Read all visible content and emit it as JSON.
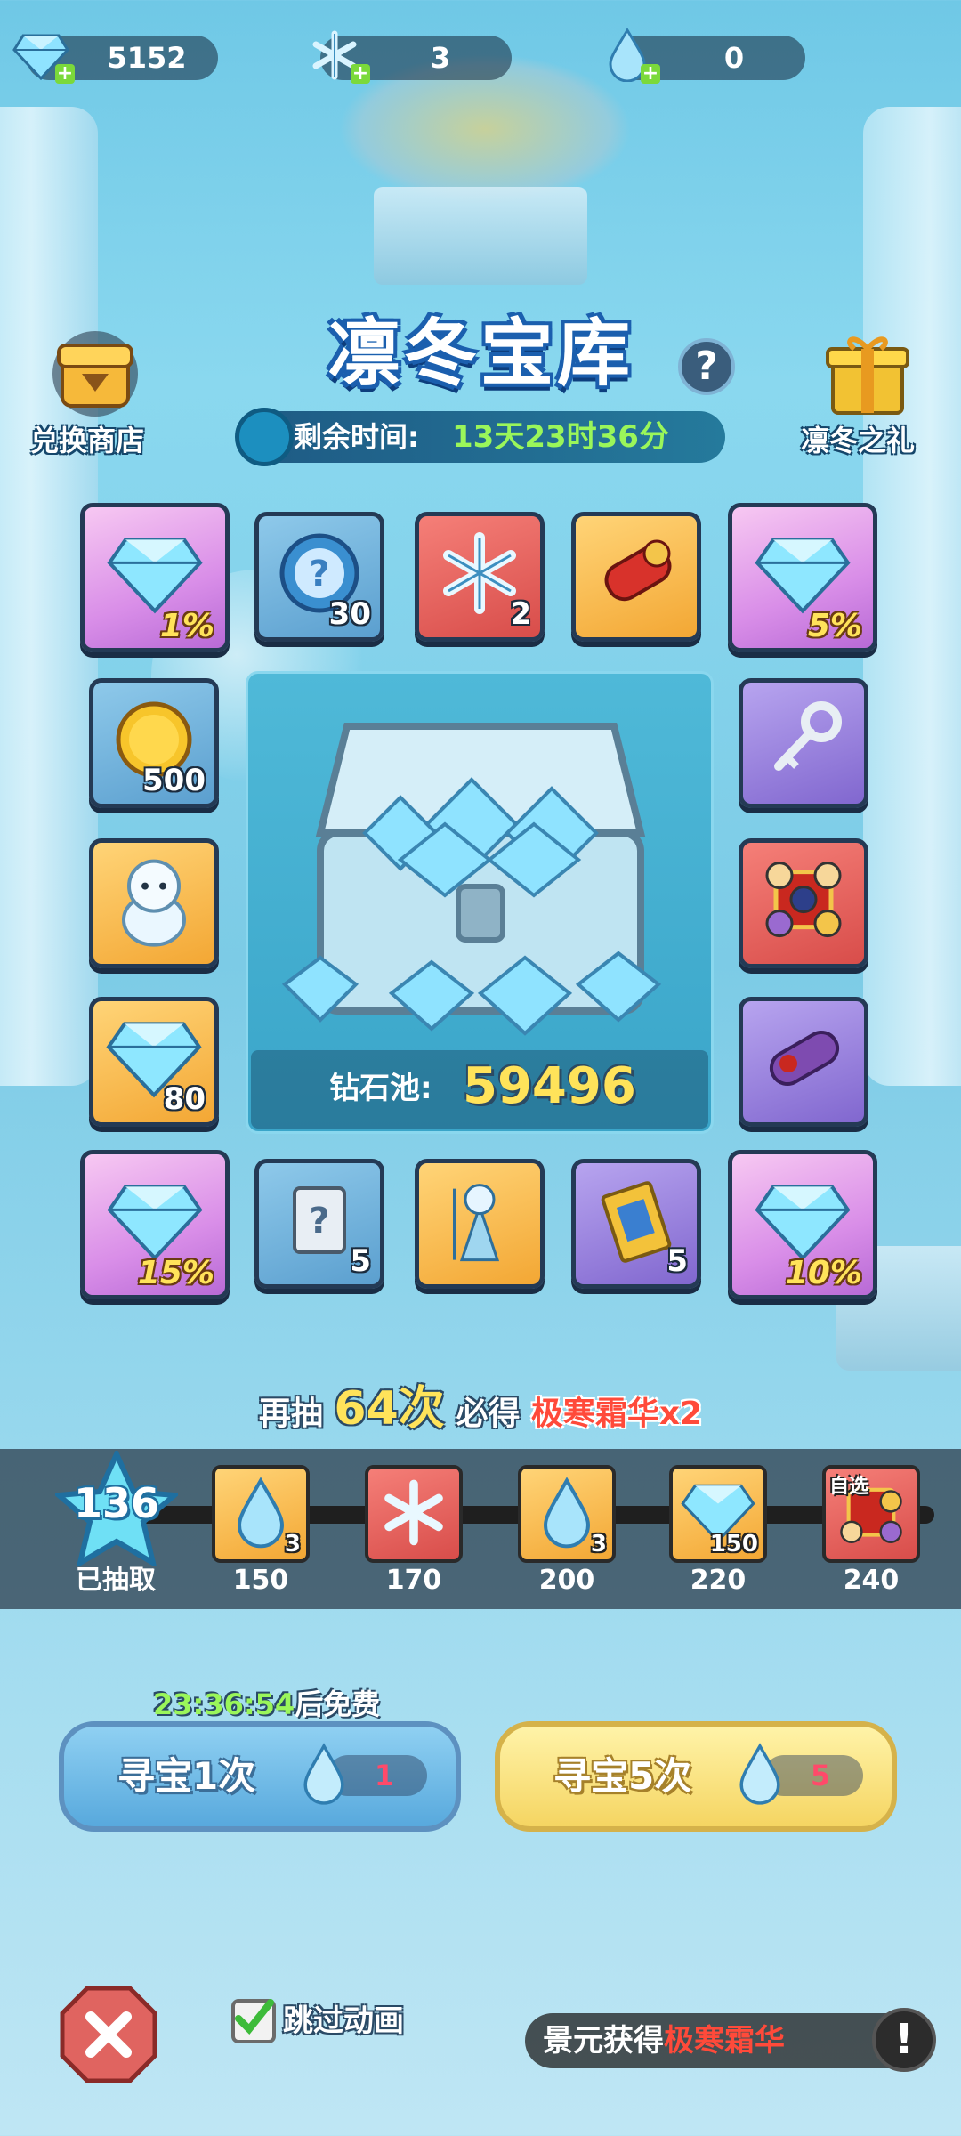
{
  "currencies": [
    {
      "name": "diamond",
      "value": "5152",
      "icon": "diamond-icon"
    },
    {
      "name": "snowflake",
      "value": "3",
      "icon": "snowflake-icon"
    },
    {
      "name": "ice-drop",
      "value": "0",
      "icon": "ice-drop-icon"
    }
  ],
  "header": {
    "title": "凛冬宝库",
    "timer_label": "剩余时间:",
    "timer_value": "13天23时36分"
  },
  "side": {
    "shop_label": "兑换商店",
    "gift_label": "凛冬之礼"
  },
  "grid": {
    "top_row": [
      {
        "type": "diamond",
        "text": "1%",
        "color": "pink"
      },
      {
        "type": "mystery-orb",
        "text": "30",
        "color": "blue"
      },
      {
        "type": "snowflake",
        "text": "2",
        "color": "red"
      },
      {
        "type": "red-scroll",
        "text": "",
        "color": "gold"
      },
      {
        "type": "diamond",
        "text": "5%",
        "color": "pink"
      }
    ],
    "left_col": [
      {
        "type": "gold-coin",
        "text": "500",
        "color": "blue"
      },
      {
        "type": "snow-creature",
        "text": "",
        "color": "gold"
      },
      {
        "type": "diamond",
        "text": "80",
        "color": "gold"
      }
    ],
    "right_col": [
      {
        "type": "key",
        "text": "",
        "color": "purple"
      },
      {
        "type": "hero-pack",
        "text": "",
        "color": "red"
      },
      {
        "type": "purple-scroll",
        "text": "",
        "color": "purple"
      }
    ],
    "bottom_row": [
      {
        "type": "diamond",
        "text": "15%",
        "color": "pink"
      },
      {
        "type": "mystery-scroll",
        "text": "5",
        "color": "blue"
      },
      {
        "type": "ice-queen",
        "text": "",
        "color": "gold"
      },
      {
        "type": "ticket",
        "text": "5",
        "color": "purple"
      },
      {
        "type": "diamond",
        "text": "10%",
        "color": "pink"
      }
    ]
  },
  "pool": {
    "label": "钻石池:",
    "value": "59496"
  },
  "guarantee": {
    "prefix": "再抽",
    "count": "64次",
    "middle": "必得",
    "reward": "极寒霜华x2"
  },
  "progress": {
    "drawn_count": "136",
    "drawn_label": "已抽取",
    "milestones": [
      {
        "threshold": "150",
        "item": "ice-drop",
        "qty": "3",
        "color": "gold"
      },
      {
        "threshold": "170",
        "item": "snowflake",
        "qty": "",
        "color": "red"
      },
      {
        "threshold": "200",
        "item": "ice-drop",
        "qty": "3",
        "color": "gold"
      },
      {
        "threshold": "220",
        "item": "diamond",
        "qty": "150",
        "color": "gold"
      },
      {
        "threshold": "240",
        "item": "hero-pack",
        "qty": "自选",
        "color": "red"
      }
    ]
  },
  "free": {
    "time": "23:36:54",
    "suffix": "后免费"
  },
  "buttons": {
    "draw1_label": "寻宝1次",
    "draw1_cost": "1",
    "draw5_label": "寻宝5次",
    "draw5_cost": "5"
  },
  "footer": {
    "skip_label": "跳过动画",
    "ticker_prefix": "景元获得",
    "ticker_item": "极寒霜华",
    "notice": "!"
  }
}
